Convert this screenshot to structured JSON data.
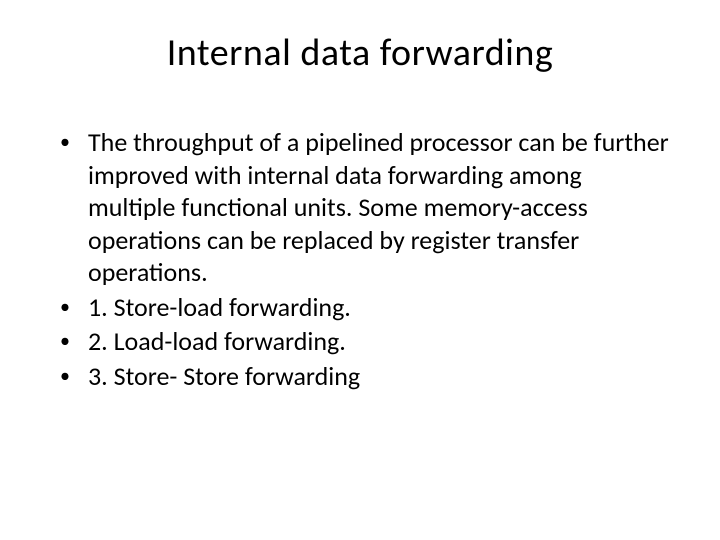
{
  "slide": {
    "title": "Internal data forwarding",
    "bullets": [
      {
        "text": "The throughput of a pipelined processor can be further improved with internal data forwarding among multiple functional units. Some memory-access operations can be replaced by register transfer operations."
      },
      {
        "text": "1. Store-load forwarding."
      },
      {
        "text": "2. Load-load forwarding."
      },
      {
        "text": "3. Store- Store forwarding"
      }
    ],
    "bullet_char": "•"
  }
}
